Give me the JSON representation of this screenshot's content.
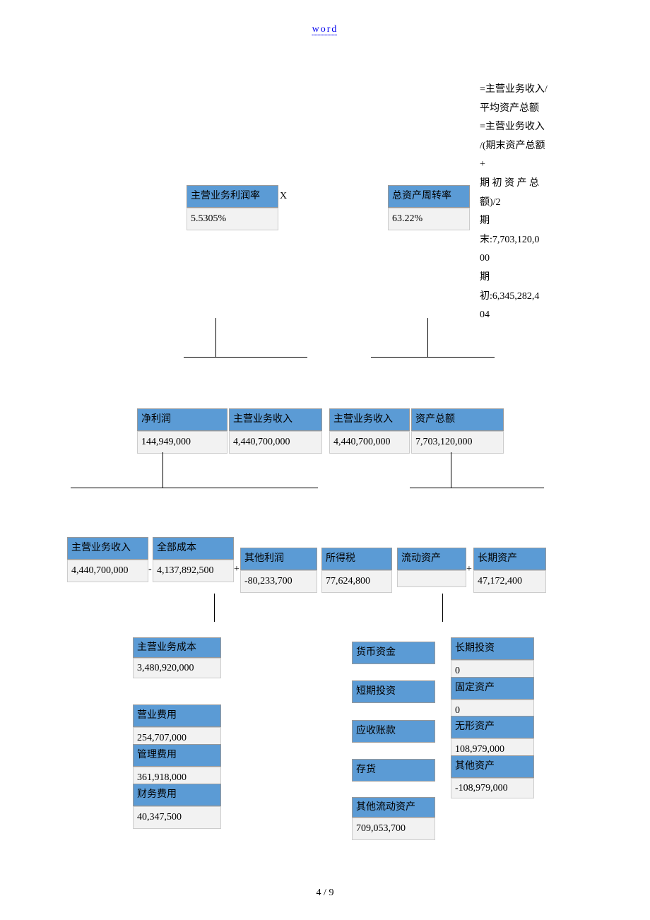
{
  "header": {
    "link": "word"
  },
  "formula": {
    "line1": "=主营业务收入/",
    "line2": "平均资产总额",
    "line3": "=主营业务收入",
    "line4": "/(期末资产总额",
    "line5": "+",
    "line6_a": "期 初 资 产 总",
    "line6_b": "额)/2",
    "line7": "期",
    "line8": "末:7,703,120,0",
    "line9": "00",
    "line10": "期",
    "line11": "初:6,345,282,4",
    "line12": "04"
  },
  "top_left": {
    "header": "主营业务利润率",
    "value": "5.5305%",
    "op": "X"
  },
  "top_right": {
    "header": "总资产周转率",
    "value": "63.22%"
  },
  "row2": {
    "c1_h": "净利润",
    "c1_v": "144,949,000",
    "c2_h": "主营业务收入",
    "c2_v": "4,440,700,000",
    "c3_h": "主营业务收入",
    "c3_v": "4,440,700,000",
    "c4_h": "资产总额",
    "c4_v": "7,703,120,000",
    "op": "÷"
  },
  "row3": {
    "c1_h": "主营业务收入",
    "c1_v": "4,440,700,000",
    "c2_h": "全部成本",
    "c2_v": "4,137,892,500",
    "c3_h": "其他利润",
    "c3_v": "-80,233,700",
    "c4_h": "所得税",
    "c4_v": "77,624,800",
    "c5_h": "流动资产",
    "c5_v": "",
    "c6_h": "长期资产",
    "c6_v": "47,172,400",
    "op1": "-",
    "op2": "+",
    "op3": "+"
  },
  "col_left": {
    "c1_h": "主营业务成本",
    "c1_v": "3,480,920,000",
    "c2_h": "营业费用",
    "c2_v": "254,707,000",
    "c3_h": "管理费用",
    "c3_v": "361,918,000",
    "c4_h": "财务费用",
    "c4_v": "40,347,500"
  },
  "col_mid": {
    "c1_h": "货币资金",
    "c2_h": "短期投资",
    "c3_h": "应收账款",
    "c4_h": "存货",
    "c5_h": "其他流动资产",
    "c5_v": "709,053,700"
  },
  "col_right": {
    "c1_h": "长期投资",
    "c1_v": "0",
    "c2_h": "固定资产",
    "c2_v": "0",
    "c3_h": "无形资产",
    "c3_v": "108,979,000",
    "c4_h": "其他资产",
    "c4_v": "-108,979,000"
  },
  "footer": {
    "page": "4 / 9"
  }
}
